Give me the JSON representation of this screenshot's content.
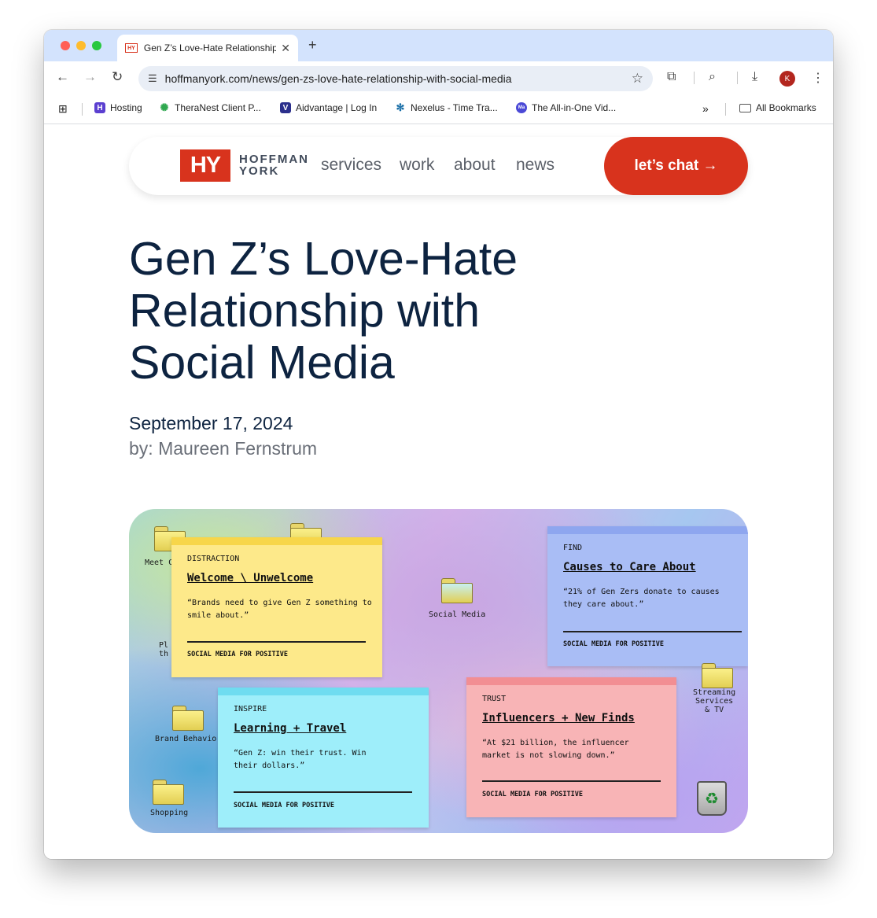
{
  "browser": {
    "tab_title": "Gen Z’s Love-Hate Relationship with Social Media",
    "tab_favicon_text": "HY",
    "new_tab_symbol": "+",
    "close_symbol": "✕",
    "url": "hoffmanyork.com/news/gen-zs-love-hate-relationship-with-social-media",
    "avatar_initial": "K",
    "icons": [
      "back-icon",
      "forward-icon",
      "reload-icon",
      "site-settings-icon",
      "bookmark-star-icon",
      "extensions-icon",
      "tab-search-icon",
      "download-icon",
      "more-icon"
    ]
  },
  "bookmarks": {
    "items": [
      {
        "label": "Hosting"
      },
      {
        "label": "TheraNest Client P..."
      },
      {
        "label": "Aidvantage | Log In"
      },
      {
        "label": "Nexelus - Time Tra..."
      },
      {
        "label": "The All-in-One Vid..."
      }
    ],
    "overflow_symbol": "»",
    "all_bookmarks": "All Bookmarks"
  },
  "site": {
    "logo_mark": "HY",
    "logo_line1": "HOFFMAN",
    "logo_line2": "YORK",
    "nav": [
      {
        "label": "services"
      },
      {
        "label": "work"
      },
      {
        "label": "about"
      },
      {
        "label": "news"
      }
    ],
    "cta": "let’s chat →",
    "accent_color": "#d8331d",
    "title_color": "#0d2340"
  },
  "article": {
    "title": "Gen Z’s Love-Hate Relationship with Social Media",
    "date": "September 17, 2024",
    "byline": "by: Maureen Fernstrum"
  },
  "hero": {
    "desktop_icons": [
      {
        "label": "Meet C"
      },
      {
        "label": "Pl\nth"
      },
      {
        "label": "Social Media"
      },
      {
        "label": "Brand Behavior"
      },
      {
        "label": "Shopping"
      },
      {
        "label": "Streaming\nServices\n& TV"
      }
    ],
    "notes": [
      {
        "category": "DISTRACTION",
        "heading": "Welcome \\ Unwelcome",
        "quote": "“Brands need to give Gen Z something to smile about.”",
        "footer": "SOCIAL MEDIA FOR POSITIVE",
        "color": "#fde98a"
      },
      {
        "category": "FIND",
        "heading": "Causes to Care About",
        "quote": "“21% of Gen Zers donate to causes they care about.”",
        "footer": "SOCIAL MEDIA FOR POSITIVE",
        "color": "#a9bdf5"
      },
      {
        "category": "INSPIRE",
        "heading": "Learning + Travel",
        "quote": "“Gen Z: win their trust. Win their dollars.”",
        "footer": "SOCIAL MEDIA FOR POSITIVE",
        "color": "#9eeefa"
      },
      {
        "category": "TRUST",
        "heading": "Influencers + New Finds",
        "quote": "“At $21 billion, the influencer market is not slowing down.”",
        "footer": "SOCIAL MEDIA FOR POSITIVE",
        "color": "#f8b4b6"
      }
    ]
  }
}
